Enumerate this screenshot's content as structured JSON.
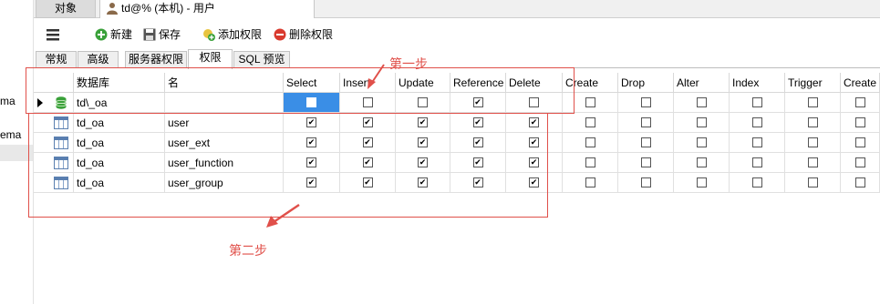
{
  "left_panel": {
    "items": [
      "ma",
      "ema"
    ]
  },
  "top_tabs": {
    "objects": "对象",
    "user_tab": "td@% (本机) - 用户"
  },
  "toolbar": {
    "menu_icon": "hamburger-icon",
    "new_label": "新建",
    "save_label": "保存",
    "add_privilege_label": "添加权限",
    "delete_privilege_label": "删除权限"
  },
  "sub_tabs": [
    "常规",
    "高级",
    "服务器权限",
    "权限",
    "SQL 预览"
  ],
  "active_sub_tab": "权限",
  "grid": {
    "columns": [
      "数据库",
      "名",
      "Select",
      "Insert",
      "Update",
      "Reference",
      "Delete",
      "Create",
      "Drop",
      "Alter",
      "Index",
      "Trigger",
      "Create"
    ],
    "rows": [
      {
        "type": "database",
        "db": "td\\_oa",
        "name": "",
        "privs": [
          false,
          false,
          false,
          true,
          false,
          false,
          false,
          false,
          false,
          false,
          false
        ]
      },
      {
        "type": "table",
        "db": "td_oa",
        "name": "user",
        "privs": [
          true,
          true,
          true,
          true,
          true,
          false,
          false,
          false,
          false,
          false,
          false
        ]
      },
      {
        "type": "table",
        "db": "td_oa",
        "name": "user_ext",
        "privs": [
          true,
          true,
          true,
          true,
          true,
          false,
          false,
          false,
          false,
          false,
          false
        ]
      },
      {
        "type": "table",
        "db": "td_oa",
        "name": "user_function",
        "privs": [
          true,
          true,
          true,
          true,
          true,
          false,
          false,
          false,
          false,
          false,
          false
        ]
      },
      {
        "type": "table",
        "db": "td_oa",
        "name": "user_group",
        "privs": [
          true,
          true,
          true,
          true,
          true,
          false,
          false,
          false,
          false,
          false,
          false
        ]
      }
    ]
  },
  "annotations": {
    "step1": "第一步",
    "step2": "第二步",
    "color": "#e0504a"
  }
}
